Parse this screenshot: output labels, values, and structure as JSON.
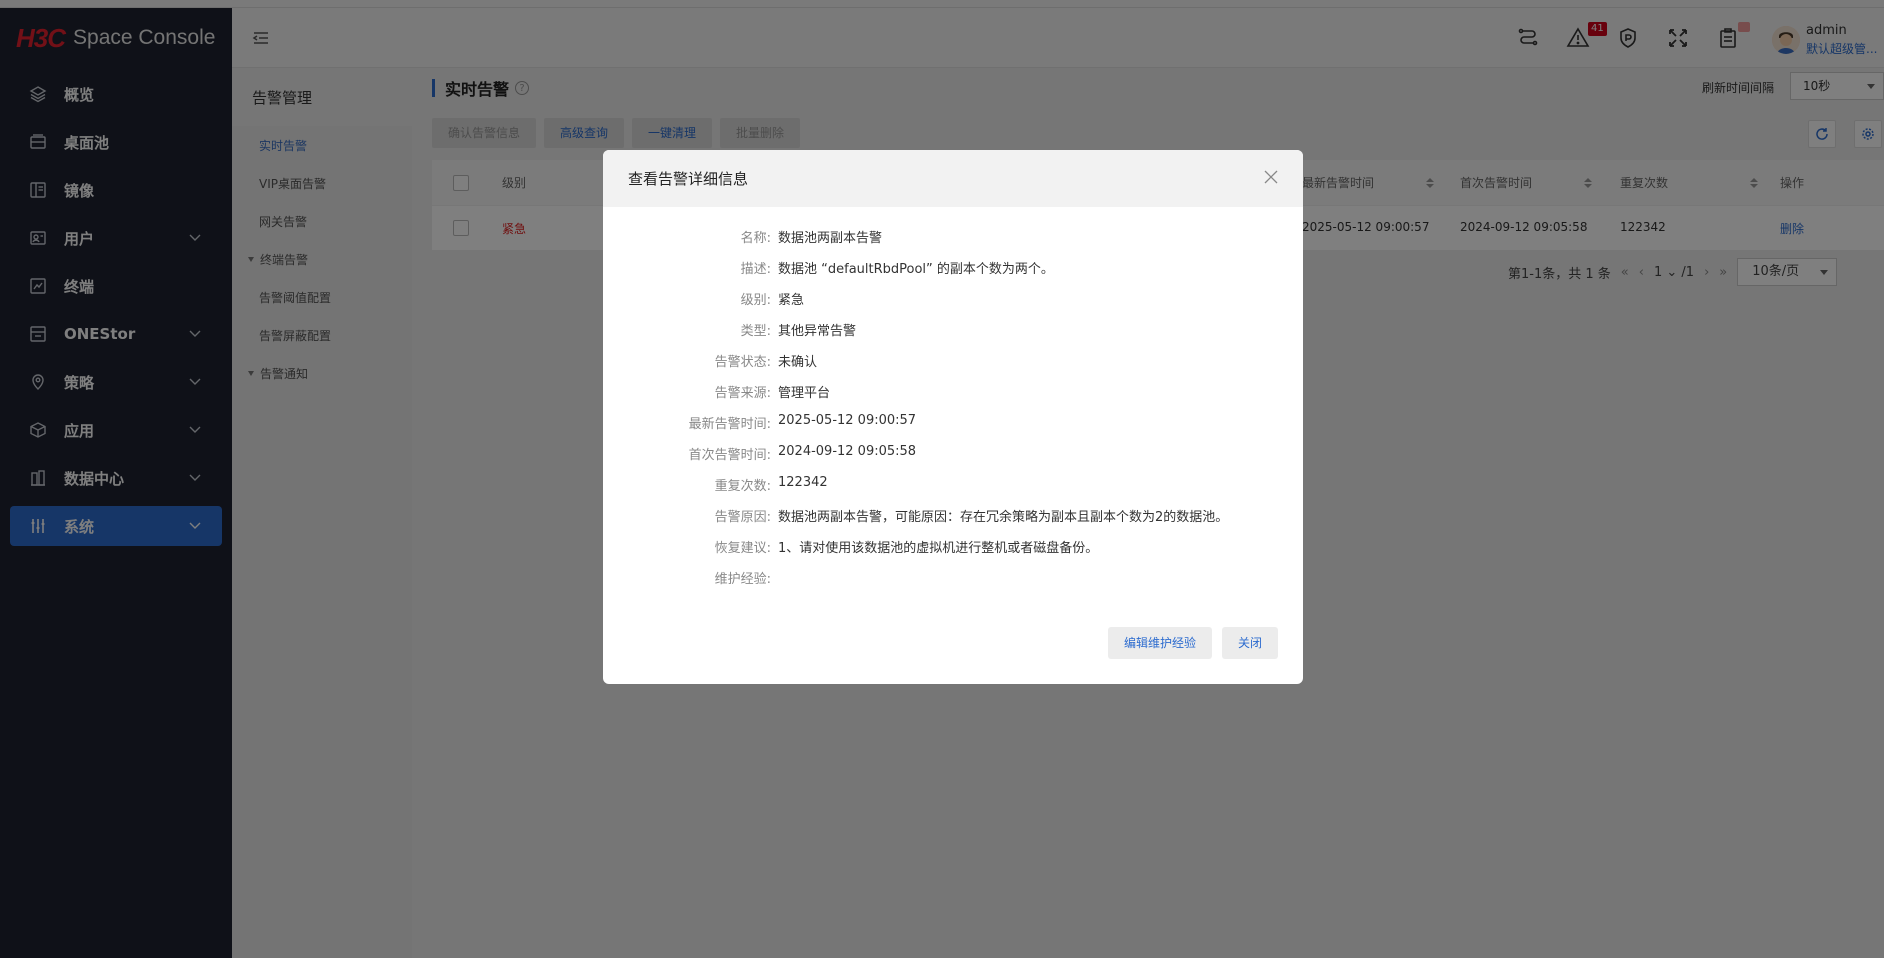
{
  "app": {
    "logo_mark": "H3C",
    "logo_text": "Space Console"
  },
  "sidebar": {
    "items": [
      {
        "label": "概览",
        "icon": "layers-icon",
        "has_children": false
      },
      {
        "label": "桌面池",
        "icon": "desktop-pool-icon",
        "has_children": false
      },
      {
        "label": "镜像",
        "icon": "image-icon",
        "has_children": false
      },
      {
        "label": "用户",
        "icon": "user-icon",
        "has_children": true
      },
      {
        "label": "终端",
        "icon": "terminal-icon",
        "has_children": false
      },
      {
        "label": "ONEStor",
        "icon": "storage-icon",
        "has_children": true
      },
      {
        "label": "策略",
        "icon": "policy-icon",
        "has_children": true
      },
      {
        "label": "应用",
        "icon": "app-icon",
        "has_children": true
      },
      {
        "label": "数据中心",
        "icon": "datacenter-icon",
        "has_children": true
      },
      {
        "label": "系统",
        "icon": "system-icon",
        "has_children": true,
        "active": true
      }
    ]
  },
  "subnav": {
    "title": "告警管理",
    "items": [
      {
        "label": "实时告警",
        "active": true
      },
      {
        "label": "VIP桌面告警"
      },
      {
        "label": "网关告警"
      },
      {
        "label": "终端告警",
        "group": true
      },
      {
        "label": "告警阈值配置"
      },
      {
        "label": "告警屏蔽配置"
      },
      {
        "label": "告警通知",
        "group": true
      }
    ]
  },
  "header": {
    "alarm_count": "41",
    "user_name": "admin",
    "user_role": "默认超级管..."
  },
  "main": {
    "title": "实时告警",
    "refresh_label": "刷新时间间隔",
    "refresh_value": "10秒",
    "toolbar": {
      "confirm": "确认告警信息",
      "advanced_query": "高级查询",
      "one_click_clear": "一键清理",
      "batch_delete": "批量删除"
    },
    "table": {
      "headers": {
        "level": "级别",
        "latest_time": "最新告警时间",
        "first_time": "首次告警时间",
        "repeat": "重复次数",
        "action": "操作"
      },
      "rows": [
        {
          "level": "紧急",
          "latest_time": "2025-05-12 09:00:57",
          "first_time": "2024-09-12 09:05:58",
          "repeat": "122342",
          "action": "删除"
        }
      ]
    },
    "pager": {
      "summary": "第1-1条，共 1 条",
      "page": "1",
      "total": "/1",
      "page_size": "10条/页"
    }
  },
  "modal": {
    "title": "查看告警详细信息",
    "fields": [
      {
        "label": "名称:",
        "value": "数据池两副本告警"
      },
      {
        "label": "描述:",
        "value": "数据池 “defaultRbdPool” 的副本个数为两个。"
      },
      {
        "label": "级别:",
        "value": "紧急"
      },
      {
        "label": "类型:",
        "value": "其他异常告警"
      },
      {
        "label": "告警状态:",
        "value": "未确认"
      },
      {
        "label": "告警来源:",
        "value": "管理平台"
      },
      {
        "label": "最新告警时间:",
        "value": "2025-05-12 09:00:57"
      },
      {
        "label": "首次告警时间:",
        "value": "2024-09-12 09:05:58"
      },
      {
        "label": "重复次数:",
        "value": "122342"
      },
      {
        "label": "告警原因:",
        "value": "数据池两副本告警，可能原因：存在冗余策略为副本且副本个数为2的数据池。"
      },
      {
        "label": "恢复建议:",
        "value": "1、请对使用该数据池的虚拟机进行整机或者磁盘备份。"
      },
      {
        "label": "维护经验:",
        "value": ""
      }
    ],
    "edit_button": "编辑维护经验",
    "close_button": "关闭"
  },
  "colors": {
    "accent": "#2d6ccf",
    "urgent": "#e02020",
    "sidebar_bg": "#1e2330",
    "brand": "#e5202e"
  }
}
